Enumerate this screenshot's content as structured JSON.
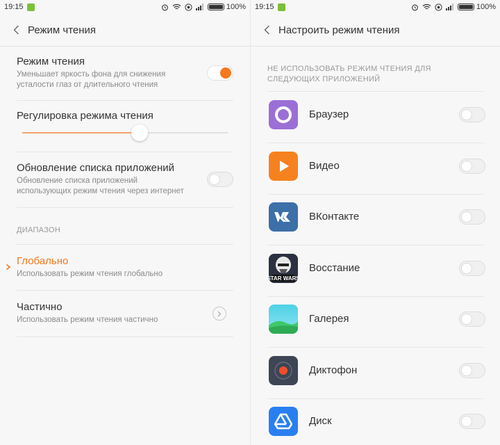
{
  "left": {
    "status": {
      "time": "19:15",
      "battery": "100%"
    },
    "title": "Режим чтения",
    "reading_mode": {
      "label": "Режим чтения",
      "description": "Уменьшает яркость фона для снижения усталости глаз от длительного чтения",
      "enabled": true
    },
    "adjust": {
      "label": "Регулировка режима чтения",
      "level": 0.57
    },
    "update": {
      "label": "Обновление списка приложений",
      "description": "Обновление списка приложений использующих режим чтения через интернет",
      "enabled": false
    },
    "range_header": "ДИАПАЗОН",
    "global": {
      "label": "Глобально",
      "description": "Использовать режим чтения глобально"
    },
    "partial": {
      "label": "Частично",
      "description": "Использовать режим чтения частично"
    }
  },
  "right": {
    "status": {
      "time": "19:15",
      "battery": "100%"
    },
    "title": "Настроить режим чтения",
    "header": "НЕ ИСПОЛЬЗОВАТЬ РЕЖИМ ЧТЕНИЯ ДЛЯ СЛЕДУЮЩИХ ПРИЛОЖЕНИЙ",
    "apps": [
      {
        "name": "Браузер",
        "icon": "browser-icon",
        "color": "#9b6fd6"
      },
      {
        "name": "Видео",
        "icon": "video-icon",
        "color": "#f5821f"
      },
      {
        "name": "ВКонтакте",
        "icon": "vk-icon",
        "color": "#3d6fa8"
      },
      {
        "name": "Восстание",
        "icon": "star-wars-icon",
        "color": "#2b3140"
      },
      {
        "name": "Галерея",
        "icon": "gallery-icon",
        "color": "#3ec86b"
      },
      {
        "name": "Диктофон",
        "icon": "recorder-icon",
        "color": "#3e4554"
      },
      {
        "name": "Диск",
        "icon": "drive-icon",
        "color": "#2a7ff0"
      }
    ]
  },
  "accent": "#f5781f"
}
